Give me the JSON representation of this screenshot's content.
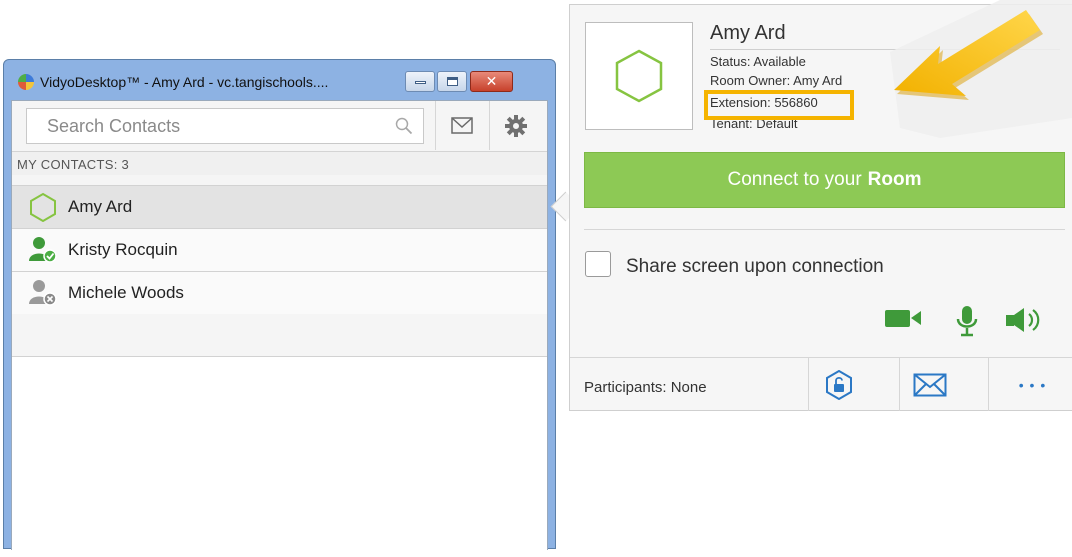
{
  "window": {
    "title": "VidyoDesktop™ - Amy Ard - vc.tangischools....",
    "close_glyph": "✕"
  },
  "search": {
    "placeholder": "Search Contacts"
  },
  "contacts": {
    "header": "MY CONTACTS: 3",
    "items": [
      {
        "name": "Amy Ard",
        "status": "room",
        "icon": "hexagon-room-icon"
      },
      {
        "name": "Kristy Rocquin",
        "status": "available",
        "icon": "user-available-icon"
      },
      {
        "name": "Michele Woods",
        "status": "offline",
        "icon": "user-offline-icon"
      }
    ]
  },
  "details": {
    "name": "Amy Ard",
    "status": "Status: Available",
    "room_owner": "Room Owner: Amy Ard",
    "extension": "Extension: 556860",
    "tenant": "Tenant: Default",
    "connect_prefix": "Connect to your",
    "connect_bold": "Room",
    "share_label": "Share screen upon connection",
    "share_checked": false,
    "participants": "Participants: None",
    "more_label": "• • •"
  },
  "colors": {
    "accent_green": "#8dc955",
    "icon_green": "#3f9a3a",
    "highlight": "#f5b400",
    "link_blue": "#2b78c5"
  }
}
